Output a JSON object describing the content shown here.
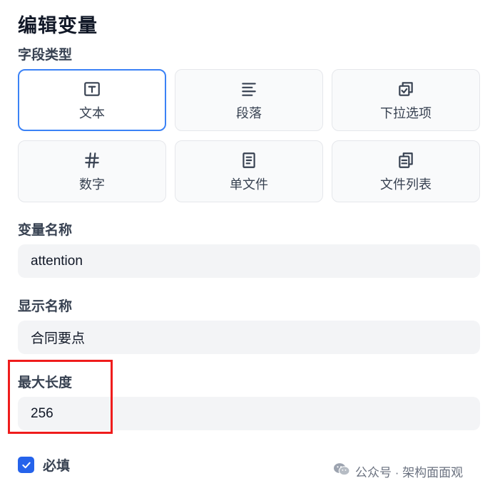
{
  "dialog": {
    "title": "编辑变量"
  },
  "field_type": {
    "label": "字段类型",
    "options": [
      {
        "label": "文本",
        "icon": "text-type-icon",
        "selected": true
      },
      {
        "label": "段落",
        "icon": "paragraph-icon",
        "selected": false
      },
      {
        "label": "下拉选项",
        "icon": "dropdown-options-icon",
        "selected": false
      },
      {
        "label": "数字",
        "icon": "hash-icon",
        "selected": false
      },
      {
        "label": "单文件",
        "icon": "file-icon",
        "selected": false
      },
      {
        "label": "文件列表",
        "icon": "file-list-icon",
        "selected": false
      }
    ]
  },
  "variable_name": {
    "label": "变量名称",
    "value": "attention"
  },
  "display_name": {
    "label": "显示名称",
    "value": "合同要点"
  },
  "max_length": {
    "label": "最大长度",
    "value": "256"
  },
  "required": {
    "label": "必填",
    "checked": true
  },
  "watermark": {
    "text": "公众号 · 架构面面观"
  },
  "colors": {
    "accent": "#3b82f6",
    "checkbox": "#2563eb",
    "highlight": "#ef1c1c",
    "field_bg": "#f3f4f6"
  }
}
